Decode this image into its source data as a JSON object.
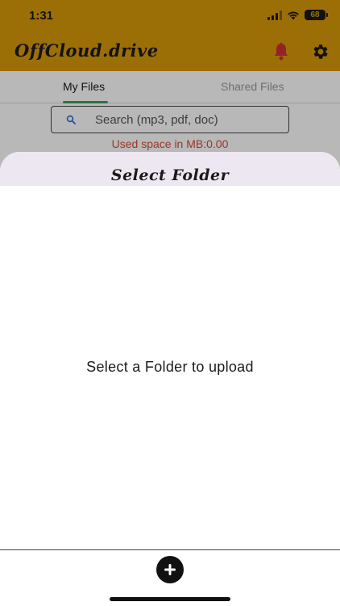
{
  "status_bar": {
    "time": "1:31",
    "battery": "68"
  },
  "app": {
    "title": "OffCloud.drive",
    "tabs": [
      {
        "label": "My Files",
        "active": true
      },
      {
        "label": "Shared Files",
        "active": false
      }
    ],
    "search": {
      "placeholder": "Search (mp3, pdf, doc)"
    },
    "used_space": "Used space in MB:0.00",
    "icons": {
      "notifications": "bell-icon",
      "settings": "gear-icon",
      "search": "search-icon",
      "add": "plus-icon"
    },
    "colors": {
      "header": "#D99A09",
      "active_tab_indicator": "#3aa35a",
      "used_space_text": "#d94a3a",
      "sheet_header": "#EDE7F2"
    }
  },
  "sheet": {
    "title": "Select Folder",
    "message": "Select a Folder to upload"
  }
}
